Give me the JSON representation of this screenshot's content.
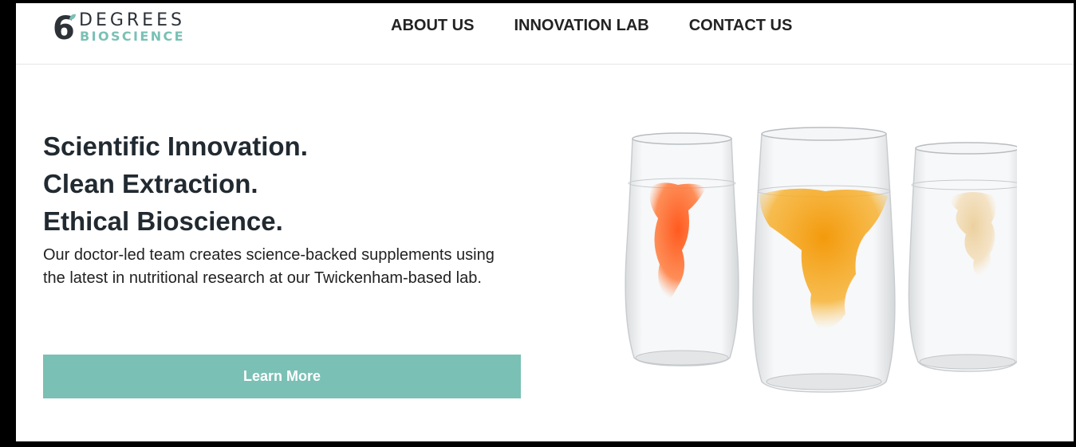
{
  "logo": {
    "number": "6",
    "line1": "DEGREES",
    "line2": "BIOSCIENCE",
    "brand_dark": "#2d3238",
    "brand_teal": "#7ac0b5"
  },
  "nav": {
    "items": [
      {
        "label": "ABOUT US"
      },
      {
        "label": "INNOVATION LAB"
      },
      {
        "label": "CONTACT US"
      }
    ]
  },
  "hero": {
    "headline": [
      "Scientific Innovation.",
      "Clean Extraction.",
      "Ethical Bioscience."
    ],
    "body": "Our doctor-led team creates science-backed supplements using the latest in nutritional research at our Twickenham-based lab.",
    "cta_label": "Learn More",
    "cta_color": "#7ac0b5",
    "image_icon": "three-glasses-with-ink-dispersions"
  }
}
